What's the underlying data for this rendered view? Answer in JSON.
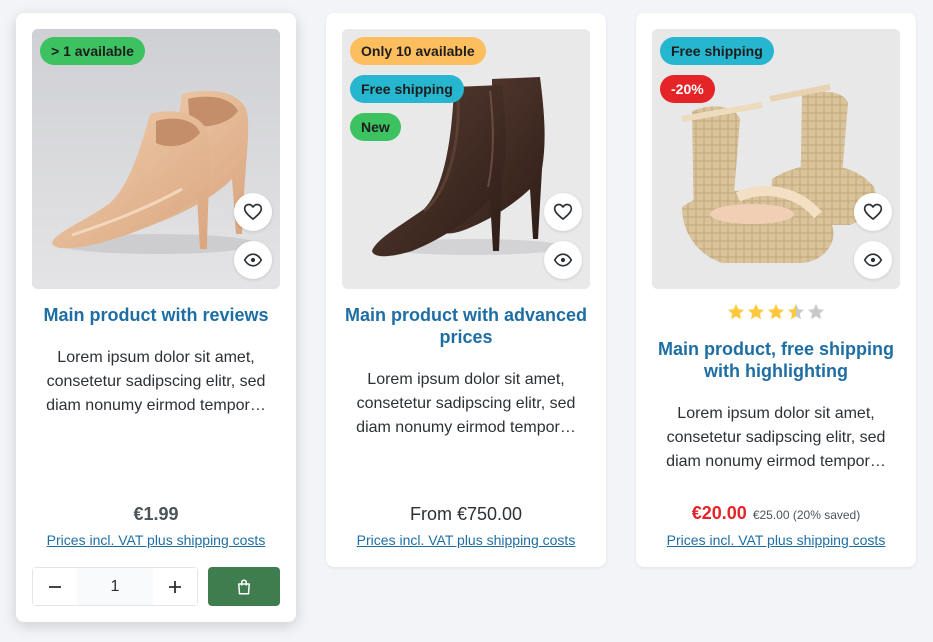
{
  "products": [
    {
      "badges": [
        {
          "label": "> 1 available",
          "color": "#3cc261"
        }
      ],
      "image": "nude-patent-pumps",
      "title": "Main product with reviews",
      "description_lines": [
        "Lorem ipsum dolor sit amet,",
        "consetetur sadipscing elitr, sed",
        "diam nonumy eirmod tempor…"
      ],
      "price": "€1.99",
      "vat_link": "Prices incl. VAT plus shipping costs",
      "quantity": "1",
      "buy_icon": "shopping-bag-icon"
    },
    {
      "badges": [
        {
          "label": "Only 10 available",
          "color": "#fdbe5d"
        },
        {
          "label": "Free shipping",
          "color": "#26b6cf"
        },
        {
          "label": "New",
          "color": "#3cc261"
        }
      ],
      "image": "brown-ankle-boots",
      "title": "Main product with advanced prices",
      "description_lines": [
        "Lorem ipsum dolor sit amet,",
        "consetetur sadipscing elitr, sed",
        "diam nonumy eirmod tempor…"
      ],
      "price": "From €750.00",
      "vat_link": "Prices incl. VAT plus shipping costs"
    },
    {
      "badges": [
        {
          "label": "Free shipping",
          "color": "#26b6cf"
        },
        {
          "label": "-20%",
          "color": "#e52427"
        }
      ],
      "image": "espadrille-wedge-sandals",
      "rating": 3.5,
      "rating_max": 5,
      "title": "Main product, free shipping with highlighting",
      "description_lines": [
        "Lorem ipsum dolor sit amet,",
        "consetetur sadipscing elitr, sed",
        "diam nonumy eirmod tempor…"
      ],
      "price": "€20.00",
      "old_price": "€25.00 (20% saved)",
      "vat_link": "Prices incl. VAT plus shipping costs"
    }
  ],
  "icons": {
    "wishlist": "heart-icon",
    "quickview": "eye-icon",
    "decrease": "minus-icon",
    "increase": "plus-icon"
  },
  "colors": {
    "link": "#1e6ea4",
    "sale": "#e52427",
    "buy_button": "#3f7d4f",
    "star": "#ffc83d"
  }
}
